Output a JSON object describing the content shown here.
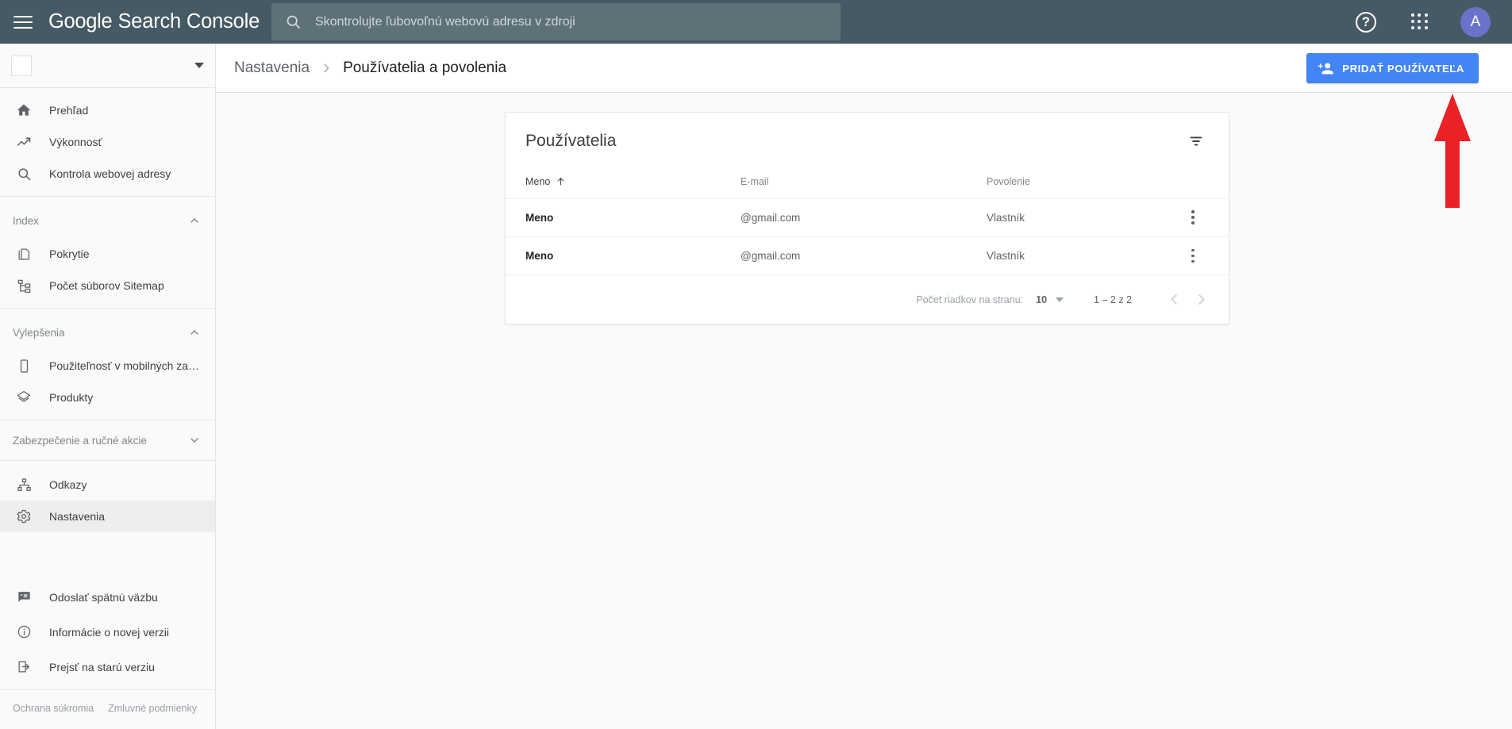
{
  "header": {
    "menu_icon": "hamburger-menu-icon",
    "brand_primary": "Google",
    "brand_secondary": "Search Console",
    "search": {
      "icon": "search-icon",
      "placeholder": "Skontrolujte ľubovoľnú webovú adresu v zdroji",
      "value": ""
    },
    "help_label": "?",
    "apps_icon": "apps-grid-icon",
    "avatar_initial": "A",
    "bg_color": "#455a64",
    "search_bg_color": "#5e7178",
    "avatar_bg_color": "#6b72c9"
  },
  "sidebar": {
    "property_selector": {
      "value": "",
      "caret_icon": "chevron-down-icon"
    },
    "main_items": [
      {
        "label": "Prehľad",
        "icon": "home-icon"
      },
      {
        "label": "Výkonnosť",
        "icon": "trending-up-icon"
      },
      {
        "label": "Kontrola webovej adresy",
        "icon": "search-icon"
      }
    ],
    "sections": [
      {
        "title": "Index",
        "expanded": true,
        "chevron": "chevron-up-icon",
        "items": [
          {
            "label": "Pokrytie",
            "icon": "pages-icon"
          },
          {
            "label": "Počet súborov Sitemap",
            "icon": "sitemap-icon"
          }
        ]
      },
      {
        "title": "Vylepšenia",
        "expanded": true,
        "chevron": "chevron-up-icon",
        "items": [
          {
            "label": "Použiteľnosť v mobilných zaria…",
            "icon": "mobile-icon"
          },
          {
            "label": "Produkty",
            "icon": "layers-icon"
          }
        ]
      },
      {
        "title": "Zabezpečenie a ručné akcie",
        "expanded": false,
        "chevron": "chevron-down-icon",
        "items": []
      }
    ],
    "bottom_items": [
      {
        "label": "Odkazy",
        "icon": "links-icon",
        "selected": false
      },
      {
        "label": "Nastavenia",
        "icon": "gear-icon",
        "selected": true
      }
    ],
    "footer_items": [
      {
        "label": "Odoslať spätnú väzbu",
        "icon": "feedback-icon"
      },
      {
        "label": "Informácie o novej verzii",
        "icon": "info-icon"
      },
      {
        "label": "Prejsť na starú verziu",
        "icon": "exit-icon"
      }
    ],
    "legal_links": [
      "Ochrana súkromia",
      "Zmluvné podmienky"
    ]
  },
  "subheader": {
    "breadcrumb": {
      "parent": "Nastavenia",
      "separator": "›",
      "current": "Používatelia a povolenia"
    },
    "add_user_button": {
      "label": "PRIDAŤ POUŽÍVATEĽA",
      "icon": "person-add-icon",
      "color": "#4285f4"
    }
  },
  "card": {
    "title": "Používatelia",
    "filter_icon": "filter-icon",
    "columns": [
      {
        "label": "Meno",
        "sorted": true,
        "sort_icon": "arrow-up-icon"
      },
      {
        "label": "E-mail",
        "sorted": false
      },
      {
        "label": "Povolenie",
        "sorted": false
      }
    ],
    "rows": [
      {
        "name": "Meno",
        "email": "@gmail.com",
        "permission": "Vlastník",
        "menu_icon": "kebab-menu-icon"
      },
      {
        "name": "Meno",
        "email": "@gmail.com",
        "permission": "Vlastník",
        "menu_icon": "kebab-menu-icon"
      }
    ],
    "pagination": {
      "rows_per_page_label": "Počet riadkov na stranu:",
      "rows_per_page_value": "10",
      "caret_icon": "chevron-down-icon",
      "range": "1 – 2 z 2",
      "prev_icon": "chevron-left-icon",
      "next_icon": "chevron-right-icon"
    }
  },
  "annotation": {
    "arrow": {
      "direction": "up",
      "color": "#ea2127",
      "points_to": "add-user-button"
    }
  }
}
